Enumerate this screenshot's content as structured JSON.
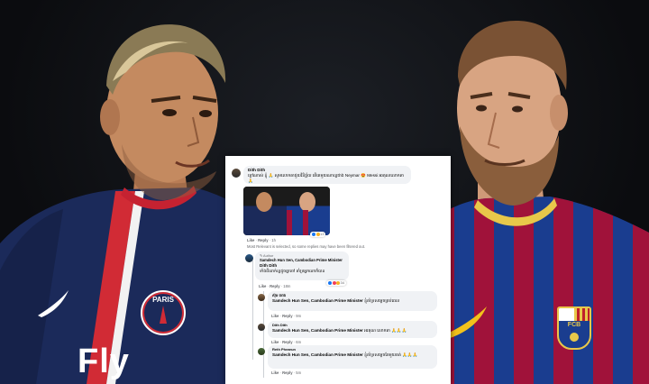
{
  "colors": {
    "psg_navy": "#1b2a5a",
    "psg_red": "#d12b35",
    "barca_blue": "#1a3d8f",
    "barca_red": "#a0123a",
    "fb_bubble": "#f0f2f5",
    "fb_meta": "#65676b"
  },
  "left_player": {
    "crest_text": "PARIS",
    "sponsor": "Fly"
  },
  "right_player": {
    "crest_letters": "FCB"
  },
  "fb": {
    "post": {
      "author": "Dith Dith",
      "text": "ក្ដៅណាស់ ខ្ញុំ 🙏 សូមលោកតាជួយវិនិច្ឆ័យ តើគេមួយណាល្អជាង Neymar 😍 Messi អរគុណលោកតា 🙏",
      "like": "Like",
      "reply": "Reply",
      "time": "1h",
      "reaction_count": "13"
    },
    "filter_notice": "Most Relevant is selected, so some replies may have been filtered out.",
    "reply1": {
      "badge": "Author",
      "author": "Samdech Hun Sen, Cambodian Prime Minister",
      "mention": "Dith Dith",
      "text": "ទាំងពីរនាក់ល្អដូចគ្នាចៅ គាំទ្រអ្នកណាក៏បាន",
      "like": "Like",
      "reply": "Reply",
      "time": "18m",
      "reaction_count": "34"
    },
    "reply2": {
      "author": "ស៊ុន ហេង",
      "mention": "Samdech Hun Sen, Cambodian Prime Minister",
      "text": "ខ្ញុំគាំទ្រសម្ដេចគ្រប់ពេល",
      "like": "Like",
      "reply": "Reply",
      "time": "9m"
    },
    "reply3": {
      "author": "Dith Dith",
      "mention": "Samdech Hun Sen, Cambodian Prime Minister",
      "text": "អរគុណ លោកតា 🙏🙏🙏",
      "like": "Like",
      "reply": "Reply",
      "time": "6m"
    },
    "reply4": {
      "author": "Reth Phearun",
      "mention": "Samdech Hun Sen, Cambodian Prime Minister",
      "text": "ខ្ញុំគាំទ្រសម្ដេចតែមួយគត់ 🙏🙏🙏",
      "like": "Like",
      "reply": "Reply",
      "time": "5m"
    }
  }
}
